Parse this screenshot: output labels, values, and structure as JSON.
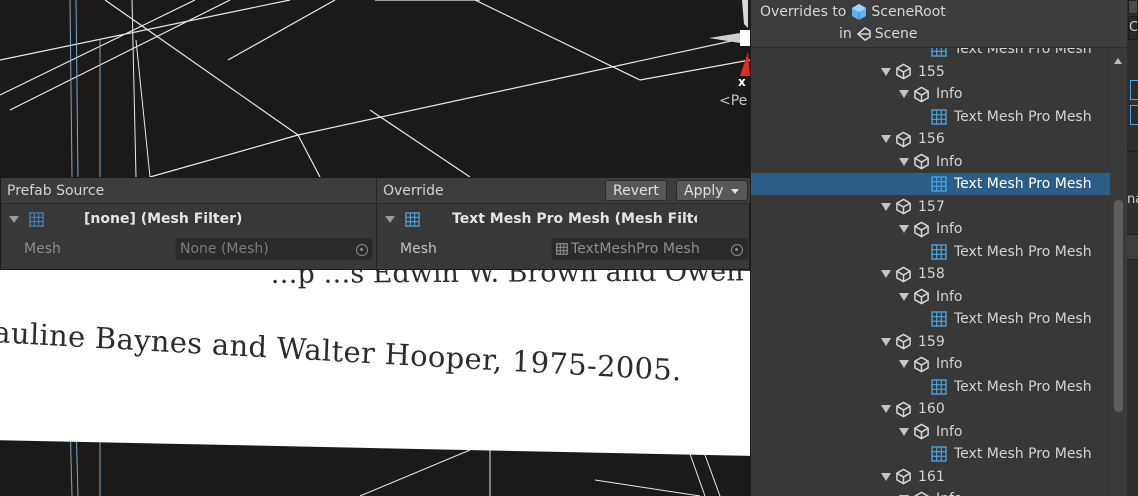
{
  "scene": {
    "plane_line_1": "…p               …s Edwin W. Brown and Owen",
    "plane_line_2": "auline Baynes and Walter Hooper, 1975-2005.",
    "gizmo_axis": "x",
    "gizmo_mode": "<Pe"
  },
  "compare": {
    "left_header": "Prefab Source",
    "right_header": "Override",
    "revert_label": "Revert",
    "apply_label": "Apply",
    "left_component": "[none] (Mesh Filter)",
    "right_component": "Text Mesh Pro Mesh (Mesh Filter",
    "mesh_label": "Mesh",
    "left_mesh_value": "None (Mesh)",
    "right_mesh_value": "TextMeshPro Mesh"
  },
  "hierarchy": {
    "title_prefix": "Overrides to",
    "root_name": "SceneRoot",
    "in_label": "in",
    "scene_name": "Scene",
    "rows": [
      {
        "label": "Text Mesh Pro Mesh",
        "kind": "mesh",
        "depth": 3,
        "partial": true
      },
      {
        "label": "155",
        "kind": "object",
        "depth": 1
      },
      {
        "label": "Info",
        "kind": "object",
        "depth": 2
      },
      {
        "label": "Text Mesh Pro Mesh",
        "kind": "mesh",
        "depth": 3
      },
      {
        "label": "156",
        "kind": "object",
        "depth": 1
      },
      {
        "label": "Info",
        "kind": "object",
        "depth": 2
      },
      {
        "label": "Text Mesh Pro Mesh",
        "kind": "mesh",
        "depth": 3,
        "selected": true
      },
      {
        "label": "157",
        "kind": "object",
        "depth": 1
      },
      {
        "label": "Info",
        "kind": "object",
        "depth": 2
      },
      {
        "label": "Text Mesh Pro Mesh",
        "kind": "mesh",
        "depth": 3
      },
      {
        "label": "158",
        "kind": "object",
        "depth": 1
      },
      {
        "label": "Info",
        "kind": "object",
        "depth": 2
      },
      {
        "label": "Text Mesh Pro Mesh",
        "kind": "mesh",
        "depth": 3
      },
      {
        "label": "159",
        "kind": "object",
        "depth": 1
      },
      {
        "label": "Info",
        "kind": "object",
        "depth": 2
      },
      {
        "label": "Text Mesh Pro Mesh",
        "kind": "mesh",
        "depth": 3
      },
      {
        "label": "160",
        "kind": "object",
        "depth": 1
      },
      {
        "label": "Info",
        "kind": "object",
        "depth": 2
      },
      {
        "label": "Text Mesh Pro Mesh",
        "kind": "mesh",
        "depth": 3
      },
      {
        "label": "161",
        "kind": "object",
        "depth": 1
      },
      {
        "label": "Info",
        "kind": "object",
        "depth": 2,
        "partial": true
      }
    ]
  },
  "edge": {
    "top_letter": "C",
    "mid_text": "na"
  },
  "colors": {
    "selection": "#2c5d87",
    "panel": "#383838",
    "scene_bg": "#1c1a18",
    "mesh_icon": "#4aa3df"
  }
}
